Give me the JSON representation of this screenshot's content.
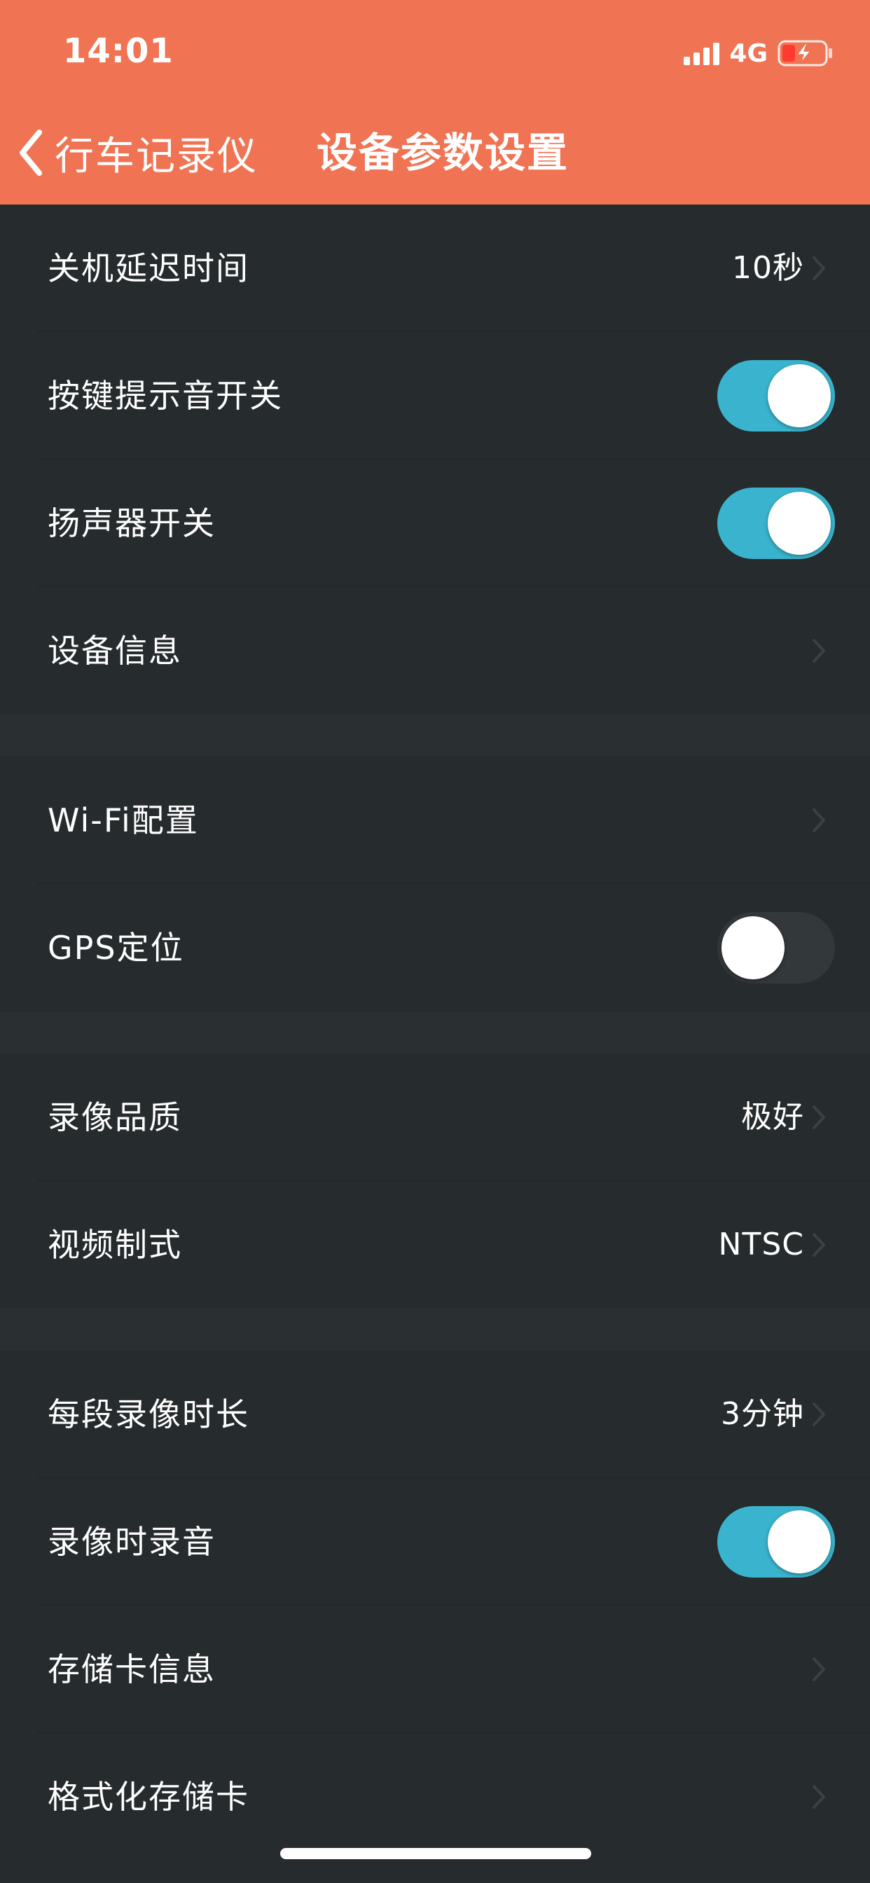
{
  "status_bar": {
    "time": "14:01",
    "network": "4G"
  },
  "nav": {
    "back_label": "行车记录仪",
    "title": "设备参数设置"
  },
  "settings": [
    {
      "label": "关机延迟时间",
      "value": "10秒",
      "type": "chevron"
    },
    {
      "label": "按键提示音开关",
      "type": "toggle",
      "on": true
    },
    {
      "label": "扬声器开关",
      "type": "toggle",
      "on": true
    },
    {
      "label": "设备信息",
      "type": "chevron"
    },
    {
      "label": "Wi-Fi配置",
      "type": "chevron"
    },
    {
      "label": "GPS定位",
      "type": "toggle",
      "on": false
    },
    {
      "label": "录像品质",
      "value": "极好",
      "type": "chevron"
    },
    {
      "label": "视频制式",
      "value": "NTSC",
      "type": "chevron"
    },
    {
      "label": "每段录像时长",
      "value": "3分钟",
      "type": "chevron"
    },
    {
      "label": "录像时录音",
      "type": "toggle",
      "on": true
    },
    {
      "label": "存储卡信息",
      "type": "chevron"
    },
    {
      "label": "格式化存储卡",
      "type": "chevron"
    }
  ],
  "colors": {
    "header_bg": "#f07454",
    "list_bg": "#262b2d",
    "toggle_on": "#3ab4ce",
    "toggle_off": "#33383b"
  }
}
